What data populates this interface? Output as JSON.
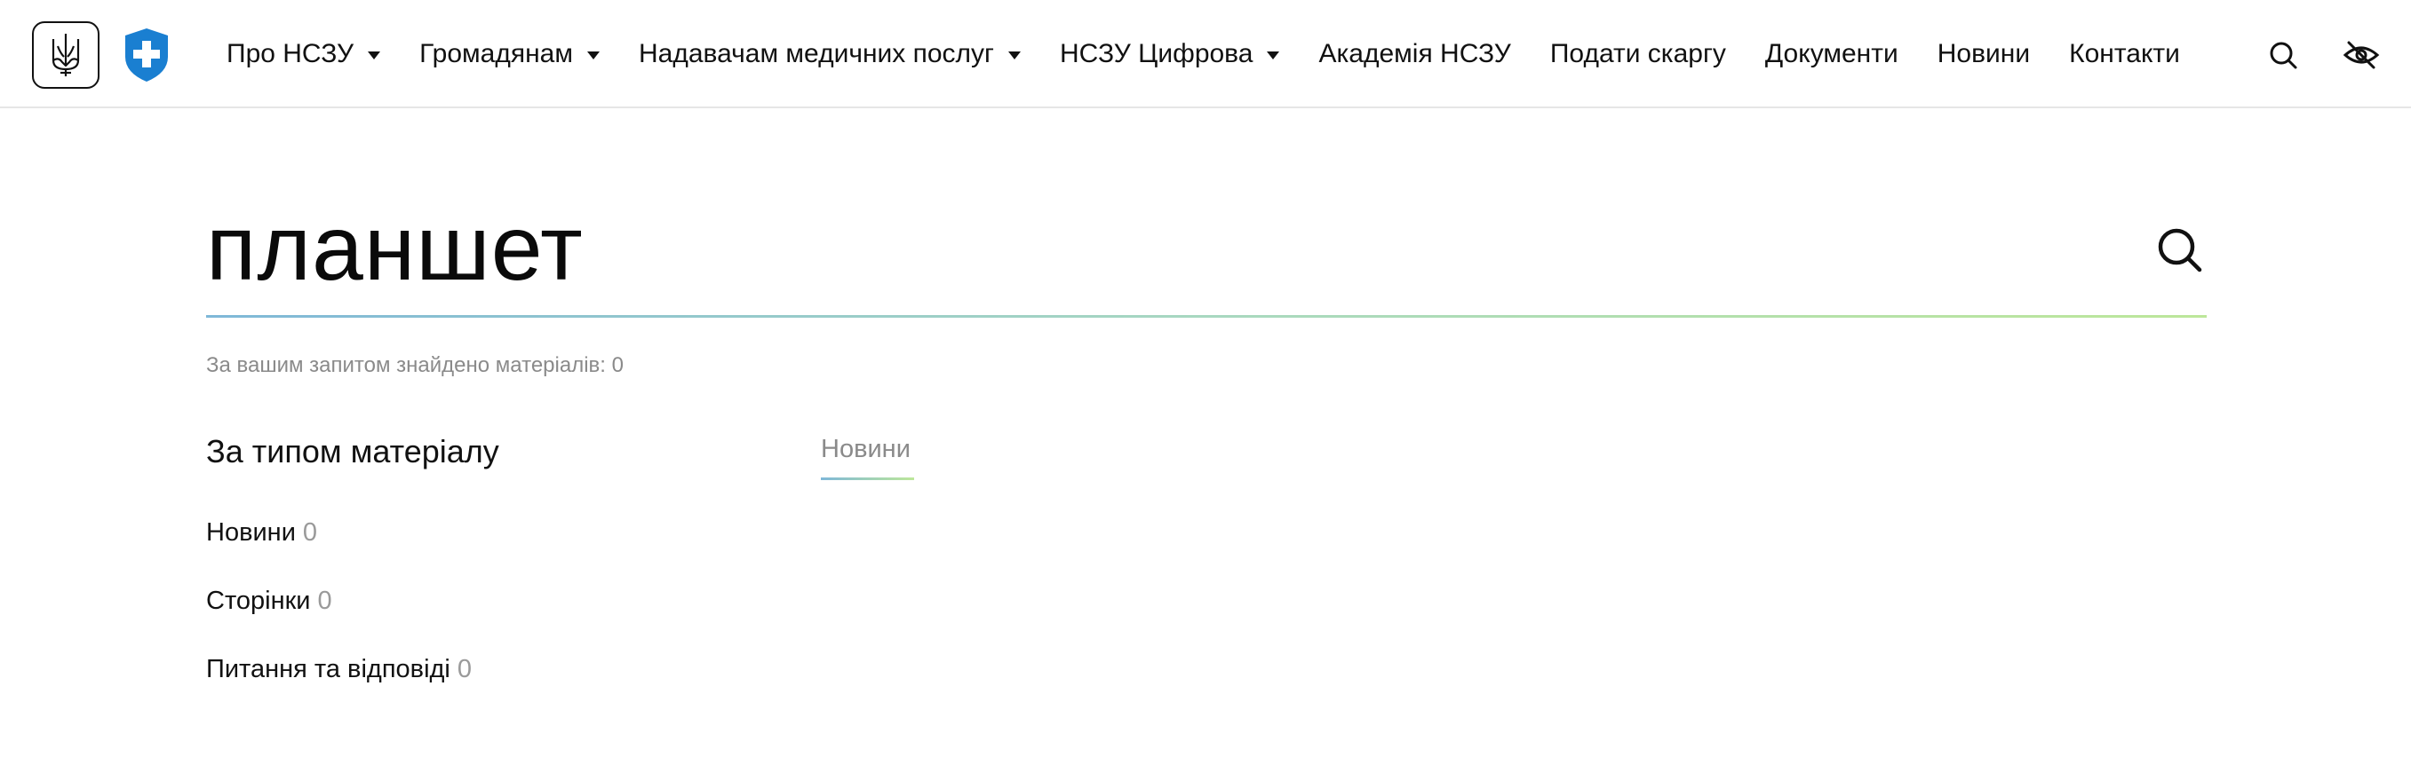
{
  "header": {
    "logo_name": "trident-icon",
    "brand_color": "#1a7fd1",
    "nav": [
      {
        "label": "Про НСЗУ",
        "dropdown": true
      },
      {
        "label": "Громадянам",
        "dropdown": true
      },
      {
        "label": "Надавачам медичних послуг",
        "dropdown": true
      },
      {
        "label": "НСЗУ Цифрова",
        "dropdown": true
      },
      {
        "label": "Академія НСЗУ",
        "dropdown": false
      },
      {
        "label": "Подати скаргу",
        "dropdown": false
      },
      {
        "label": "Документи",
        "dropdown": false
      },
      {
        "label": "Новини",
        "dropdown": false
      },
      {
        "label": "Контакти",
        "dropdown": false
      }
    ],
    "search_icon": "search-icon",
    "accessibility_icon": "eye-crossed-icon"
  },
  "search": {
    "value": "планшет",
    "results_text": "За вашим запитом знайдено матеріалів: 0"
  },
  "filters": {
    "title": "За типом матеріалу",
    "items": [
      {
        "label": "Новини",
        "count": "0"
      },
      {
        "label": "Сторінки",
        "count": "0"
      },
      {
        "label": "Питання та відповіді",
        "count": "0"
      }
    ]
  },
  "tabs": [
    {
      "label": "Новини",
      "active": true
    }
  ]
}
